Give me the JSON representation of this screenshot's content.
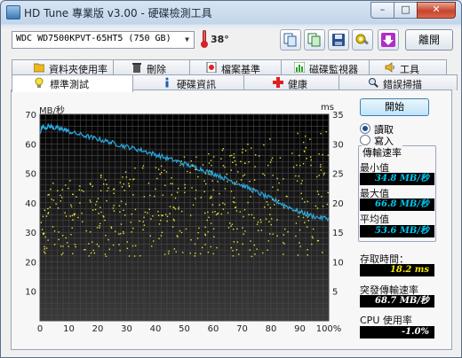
{
  "window": {
    "title": "HD Tune 專業版 v3.00 - 硬碟檢測工具"
  },
  "toolbar": {
    "drive": "WDC WD7500KPVT-65HT5 (750 GB)",
    "temperature": "38°",
    "exit_label": "離開"
  },
  "tabs_top": [
    {
      "label": "資料夾使用率",
      "icon": "folder-icon"
    },
    {
      "label": "刪除",
      "icon": "trash-icon"
    },
    {
      "label": "檔案基準",
      "icon": "file-benchmark-icon"
    },
    {
      "label": "磁碟監視器",
      "icon": "monitor-icon"
    },
    {
      "label": "工具",
      "icon": "speaker-icon"
    }
  ],
  "tabs_bottom": [
    {
      "label": "標準測試",
      "icon": "lightbulb-icon",
      "active": true
    },
    {
      "label": "硬碟資訊",
      "icon": "info-icon"
    },
    {
      "label": "健康",
      "icon": "health-cross-icon"
    },
    {
      "label": "錯誤掃描",
      "icon": "magnifier-icon"
    }
  ],
  "controls": {
    "start_label": "開始",
    "read_label": "讀取",
    "write_label": "寫入",
    "selected_mode": "read"
  },
  "stats": {
    "transfer_rate_title": "傳輸速率",
    "min_label": "最小值",
    "min_value": "34.8 MB/秒",
    "max_label": "最大值",
    "max_value": "66.8 MB/秒",
    "avg_label": "平均值",
    "avg_value": "53.6 MB/秒",
    "access_label": "存取時間：",
    "access_value": "18.2 ms",
    "burst_label": "突發傳輸速率",
    "burst_value": "68.7 MB/秒",
    "cpu_label": "CPU 使用率",
    "cpu_value": "-1.0%"
  },
  "colors": {
    "rate_line": "#2aa7e0",
    "access_dots": "#e8e238",
    "value_cyan": "#00c8f0",
    "value_yellow": "#f2e600"
  },
  "chart_data": {
    "type": "line",
    "ylabel": "MB/秒",
    "y2label": "ms",
    "xlabel": "",
    "x_ticks": [
      "0",
      "10",
      "20",
      "30",
      "40",
      "50",
      "60",
      "70",
      "80",
      "90",
      "100%"
    ],
    "y_ticks": [
      "0",
      "10",
      "20",
      "30",
      "40",
      "50",
      "60",
      "70"
    ],
    "y2_ticks": [
      "5",
      "10",
      "15",
      "20",
      "25",
      "30",
      "35"
    ],
    "xlim": [
      0,
      100
    ],
    "ylim": [
      0,
      70
    ],
    "y2lim": [
      0,
      35
    ],
    "grid": true,
    "series": [
      {
        "x": [
          0,
          1,
          2,
          3,
          4,
          5,
          6,
          7,
          8,
          9,
          10,
          12,
          14,
          16,
          18,
          20,
          22,
          24,
          26,
          28,
          30,
          32,
          34,
          36,
          38,
          40,
          42,
          44,
          46,
          48,
          50,
          52,
          54,
          56,
          58,
          60,
          62,
          64,
          66,
          68,
          70,
          72,
          74,
          76,
          78,
          80,
          82,
          84,
          86,
          88,
          90,
          92,
          94,
          96,
          98,
          100
        ],
        "values": [
          64,
          66,
          65.5,
          66,
          65.8,
          65.3,
          65.5,
          64.8,
          65,
          64.6,
          64.2,
          63.6,
          63.1,
          62.6,
          62.1,
          61.6,
          61.1,
          60.6,
          60.1,
          59.5,
          59,
          58.6,
          58.1,
          57.6,
          56.9,
          56.4,
          55.7,
          55.1,
          54.5,
          53.9,
          53.2,
          52.6,
          52,
          51.3,
          50.6,
          49.9,
          49.2,
          48.3,
          47.6,
          46.8,
          46,
          45.1,
          44.1,
          43.2,
          42.3,
          41.4,
          40.5,
          39.5,
          38.6,
          37.7,
          36.9,
          36.3,
          35.6,
          35.1,
          34.9,
          34.8
        ]
      }
    ],
    "access_time_ms": {
      "min": 11,
      "max": 33,
      "typical": 18.2
    }
  }
}
